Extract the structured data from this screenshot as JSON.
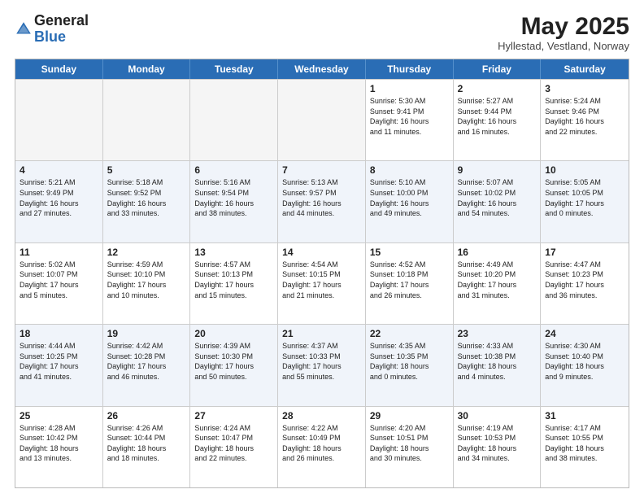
{
  "logo": {
    "general": "General",
    "blue": "Blue"
  },
  "header": {
    "month": "May 2025",
    "location": "Hyllestad, Vestland, Norway"
  },
  "weekdays": [
    "Sunday",
    "Monday",
    "Tuesday",
    "Wednesday",
    "Thursday",
    "Friday",
    "Saturday"
  ],
  "rows": [
    {
      "alt": false,
      "cells": [
        {
          "empty": true,
          "day": "",
          "info": ""
        },
        {
          "empty": true,
          "day": "",
          "info": ""
        },
        {
          "empty": true,
          "day": "",
          "info": ""
        },
        {
          "empty": true,
          "day": "",
          "info": ""
        },
        {
          "empty": false,
          "day": "1",
          "info": "Sunrise: 5:30 AM\nSunset: 9:41 PM\nDaylight: 16 hours\nand 11 minutes."
        },
        {
          "empty": false,
          "day": "2",
          "info": "Sunrise: 5:27 AM\nSunset: 9:44 PM\nDaylight: 16 hours\nand 16 minutes."
        },
        {
          "empty": false,
          "day": "3",
          "info": "Sunrise: 5:24 AM\nSunset: 9:46 PM\nDaylight: 16 hours\nand 22 minutes."
        }
      ]
    },
    {
      "alt": true,
      "cells": [
        {
          "empty": false,
          "day": "4",
          "info": "Sunrise: 5:21 AM\nSunset: 9:49 PM\nDaylight: 16 hours\nand 27 minutes."
        },
        {
          "empty": false,
          "day": "5",
          "info": "Sunrise: 5:18 AM\nSunset: 9:52 PM\nDaylight: 16 hours\nand 33 minutes."
        },
        {
          "empty": false,
          "day": "6",
          "info": "Sunrise: 5:16 AM\nSunset: 9:54 PM\nDaylight: 16 hours\nand 38 minutes."
        },
        {
          "empty": false,
          "day": "7",
          "info": "Sunrise: 5:13 AM\nSunset: 9:57 PM\nDaylight: 16 hours\nand 44 minutes."
        },
        {
          "empty": false,
          "day": "8",
          "info": "Sunrise: 5:10 AM\nSunset: 10:00 PM\nDaylight: 16 hours\nand 49 minutes."
        },
        {
          "empty": false,
          "day": "9",
          "info": "Sunrise: 5:07 AM\nSunset: 10:02 PM\nDaylight: 16 hours\nand 54 minutes."
        },
        {
          "empty": false,
          "day": "10",
          "info": "Sunrise: 5:05 AM\nSunset: 10:05 PM\nDaylight: 17 hours\nand 0 minutes."
        }
      ]
    },
    {
      "alt": false,
      "cells": [
        {
          "empty": false,
          "day": "11",
          "info": "Sunrise: 5:02 AM\nSunset: 10:07 PM\nDaylight: 17 hours\nand 5 minutes."
        },
        {
          "empty": false,
          "day": "12",
          "info": "Sunrise: 4:59 AM\nSunset: 10:10 PM\nDaylight: 17 hours\nand 10 minutes."
        },
        {
          "empty": false,
          "day": "13",
          "info": "Sunrise: 4:57 AM\nSunset: 10:13 PM\nDaylight: 17 hours\nand 15 minutes."
        },
        {
          "empty": false,
          "day": "14",
          "info": "Sunrise: 4:54 AM\nSunset: 10:15 PM\nDaylight: 17 hours\nand 21 minutes."
        },
        {
          "empty": false,
          "day": "15",
          "info": "Sunrise: 4:52 AM\nSunset: 10:18 PM\nDaylight: 17 hours\nand 26 minutes."
        },
        {
          "empty": false,
          "day": "16",
          "info": "Sunrise: 4:49 AM\nSunset: 10:20 PM\nDaylight: 17 hours\nand 31 minutes."
        },
        {
          "empty": false,
          "day": "17",
          "info": "Sunrise: 4:47 AM\nSunset: 10:23 PM\nDaylight: 17 hours\nand 36 minutes."
        }
      ]
    },
    {
      "alt": true,
      "cells": [
        {
          "empty": false,
          "day": "18",
          "info": "Sunrise: 4:44 AM\nSunset: 10:25 PM\nDaylight: 17 hours\nand 41 minutes."
        },
        {
          "empty": false,
          "day": "19",
          "info": "Sunrise: 4:42 AM\nSunset: 10:28 PM\nDaylight: 17 hours\nand 46 minutes."
        },
        {
          "empty": false,
          "day": "20",
          "info": "Sunrise: 4:39 AM\nSunset: 10:30 PM\nDaylight: 17 hours\nand 50 minutes."
        },
        {
          "empty": false,
          "day": "21",
          "info": "Sunrise: 4:37 AM\nSunset: 10:33 PM\nDaylight: 17 hours\nand 55 minutes."
        },
        {
          "empty": false,
          "day": "22",
          "info": "Sunrise: 4:35 AM\nSunset: 10:35 PM\nDaylight: 18 hours\nand 0 minutes."
        },
        {
          "empty": false,
          "day": "23",
          "info": "Sunrise: 4:33 AM\nSunset: 10:38 PM\nDaylight: 18 hours\nand 4 minutes."
        },
        {
          "empty": false,
          "day": "24",
          "info": "Sunrise: 4:30 AM\nSunset: 10:40 PM\nDaylight: 18 hours\nand 9 minutes."
        }
      ]
    },
    {
      "alt": false,
      "cells": [
        {
          "empty": false,
          "day": "25",
          "info": "Sunrise: 4:28 AM\nSunset: 10:42 PM\nDaylight: 18 hours\nand 13 minutes."
        },
        {
          "empty": false,
          "day": "26",
          "info": "Sunrise: 4:26 AM\nSunset: 10:44 PM\nDaylight: 18 hours\nand 18 minutes."
        },
        {
          "empty": false,
          "day": "27",
          "info": "Sunrise: 4:24 AM\nSunset: 10:47 PM\nDaylight: 18 hours\nand 22 minutes."
        },
        {
          "empty": false,
          "day": "28",
          "info": "Sunrise: 4:22 AM\nSunset: 10:49 PM\nDaylight: 18 hours\nand 26 minutes."
        },
        {
          "empty": false,
          "day": "29",
          "info": "Sunrise: 4:20 AM\nSunset: 10:51 PM\nDaylight: 18 hours\nand 30 minutes."
        },
        {
          "empty": false,
          "day": "30",
          "info": "Sunrise: 4:19 AM\nSunset: 10:53 PM\nDaylight: 18 hours\nand 34 minutes."
        },
        {
          "empty": false,
          "day": "31",
          "info": "Sunrise: 4:17 AM\nSunset: 10:55 PM\nDaylight: 18 hours\nand 38 minutes."
        }
      ]
    }
  ]
}
